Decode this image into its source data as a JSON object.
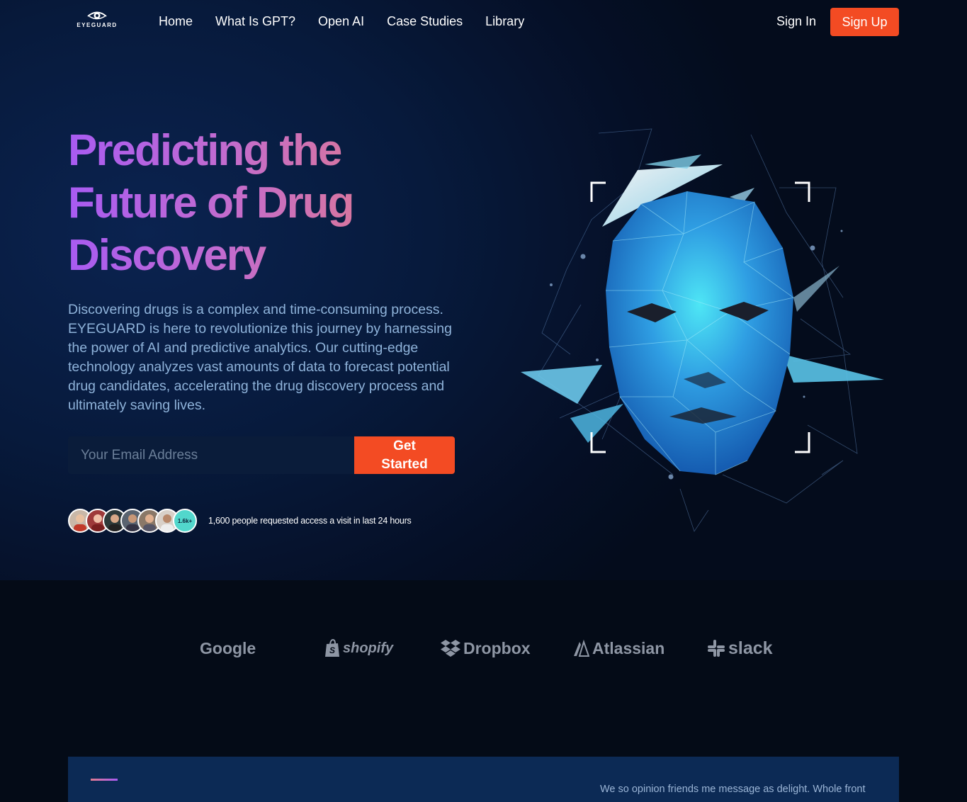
{
  "nav": {
    "logo_text": "EYEGUARD",
    "links": [
      {
        "label": "Home"
      },
      {
        "label": "What Is GPT?"
      },
      {
        "label": "Open AI"
      },
      {
        "label": "Case Studies"
      },
      {
        "label": "Library"
      }
    ],
    "sign_in": "Sign In",
    "sign_up": "Sign Up"
  },
  "hero": {
    "headline_line1": "Predicting the",
    "headline_line2": "Future of Drug",
    "headline_line3": "Discovery",
    "description": "Discovering drugs is a complex and time-consuming process. EYEGUARD is here to revolutionize this journey by harnessing the power of AI and predictive analytics. Our cutting-edge technology analyzes vast amounts of data to forecast potential drug candidates, accelerating the drug discovery process and ultimately saving lives.",
    "email_placeholder": "Your Email Address",
    "cta_label": "Get Started",
    "avatar_count": "1.6k+",
    "social_proof": "1,600 people requested access a visit in last 24 hours"
  },
  "brands": [
    {
      "name": "Google",
      "icon": "google-logo"
    },
    {
      "name": "shopify",
      "icon": "shopify-bag-icon"
    },
    {
      "name": "Dropbox",
      "icon": "dropbox-icon"
    },
    {
      "name": "Atlassian",
      "icon": "atlassian-icon"
    },
    {
      "name": "slack",
      "icon": "slack-icon"
    }
  ],
  "card": {
    "text": "We so opinion friends me message as delight. Whole front"
  },
  "colors": {
    "accent": "#f34b23",
    "headline_gradient_start": "#a85bf2",
    "headline_gradient_end": "#e07a8e",
    "avatar_count_bg": "#52d7cc"
  }
}
